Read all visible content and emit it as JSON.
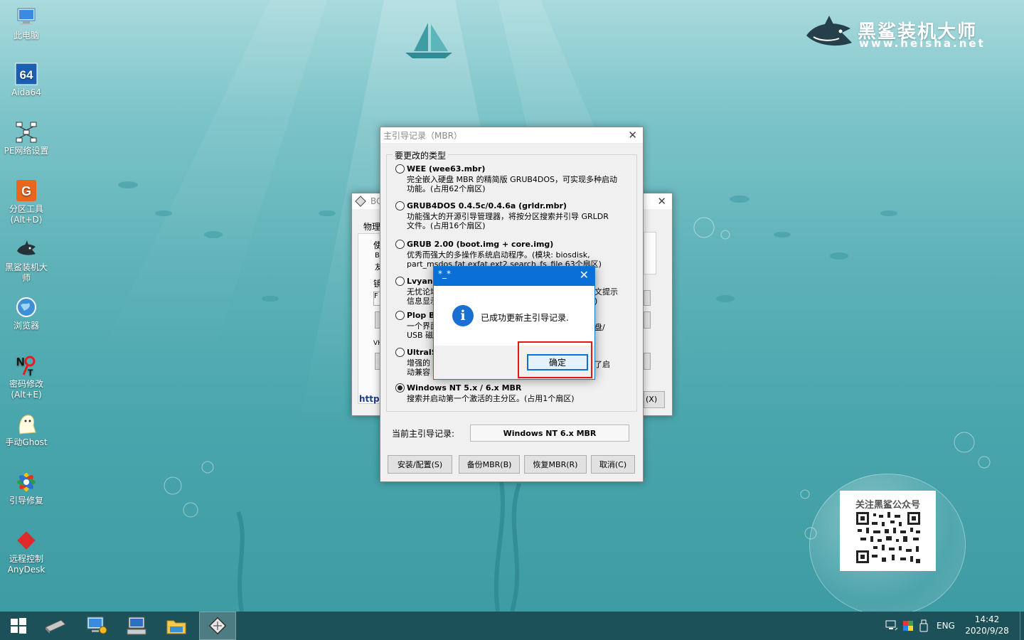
{
  "desktop": {
    "icons": [
      {
        "label": "此电脑",
        "icon": "computer-icon"
      },
      {
        "label": "Aida64",
        "icon": "aida64-icon"
      },
      {
        "label": "PE网络设置",
        "icon": "network-icon"
      },
      {
        "label": "分区工具\n(Alt+D)",
        "icon": "partition-tool-icon"
      },
      {
        "label": "黑鲨装机大\n师",
        "icon": "shark-icon"
      },
      {
        "label": "浏览器",
        "icon": "browser-icon"
      },
      {
        "label": "密码修改\n(Alt+E)",
        "icon": "password-key-icon"
      },
      {
        "label": "手动Ghost",
        "icon": "ghost-icon"
      },
      {
        "label": "引导修复",
        "icon": "boot-repair-icon"
      },
      {
        "label": "远程控制\nAnyDesk",
        "icon": "anydesk-icon"
      }
    ],
    "brand": {
      "name": "黑鲨装机大师",
      "url": "www.heisha.net"
    },
    "qr": {
      "title": "关注黑鲨公众号"
    }
  },
  "bg_window": {
    "title": "BC",
    "fragments": [
      "物理",
      "使",
      "B",
      "友",
      "镜",
      "F",
      "VH",
      "http:",
      "(X)"
    ]
  },
  "mbr_window": {
    "title": "主引导记录（MBR）",
    "group_title": "要更改的类型",
    "options": [
      {
        "head": "WEE (wee63.mbr)",
        "desc": "完全嵌入硬盘 MBR 的精简版 GRUB4DOS，可实现多种启动\n功能。(占用62个扇区)",
        "selected": false
      },
      {
        "head": "GRUB4DOS 0.4.5c/0.4.6a (grldr.mbr)",
        "desc": "功能强大的开源引导管理器，将按分区搜索并引导 GRLDR\n文件。(占用16个扇区)",
        "selected": false
      },
      {
        "head": "GRUB 2.00 (boot.img + core.img)",
        "desc": "优秀而强大的多操作系统启动程序。(模块: biosdisk,\npart_msdos fat exfat ext2 search_fs_file  63个扇区)",
        "selected": false
      },
      {
        "head": "Lvyana",
        "desc": "无忧论坛\n信息显示",
        "selected": false,
        "tail": "文提示\n)"
      },
      {
        "head": "Plop Bo",
        "desc": "一个界面\nUSB 磁盘",
        "selected": false,
        "tail": "盘/"
      },
      {
        "head": "UltraIS",
        "desc": "增强的\n动兼容",
        "selected": false,
        "tail": "了启"
      },
      {
        "head": "Windows NT 5.x / 6.x MBR",
        "desc": "搜索并启动第一个激活的主分区。(占用1个扇区)",
        "selected": true
      }
    ],
    "current_label": "当前主引导记录:",
    "current_value": "Windows NT 6.x MBR",
    "buttons": [
      "安装/配置(S)",
      "备份MBR(B)",
      "恢复MBR(R)",
      "取消(C)"
    ]
  },
  "message_box": {
    "title": "*_*",
    "text": "已成功更新主引导记录.",
    "ok_label": "确定",
    "icon": "info-icon"
  },
  "taskbar": {
    "items": [
      "start-windows-icon",
      "disk-drive-icon",
      "computer-settings-icon",
      "keyboard-terminal-icon",
      "file-explorer-icon",
      "bootice-icon"
    ],
    "active_index": 5,
    "lang": "ENG",
    "time": "14:42",
    "date": "2020/9/28"
  }
}
